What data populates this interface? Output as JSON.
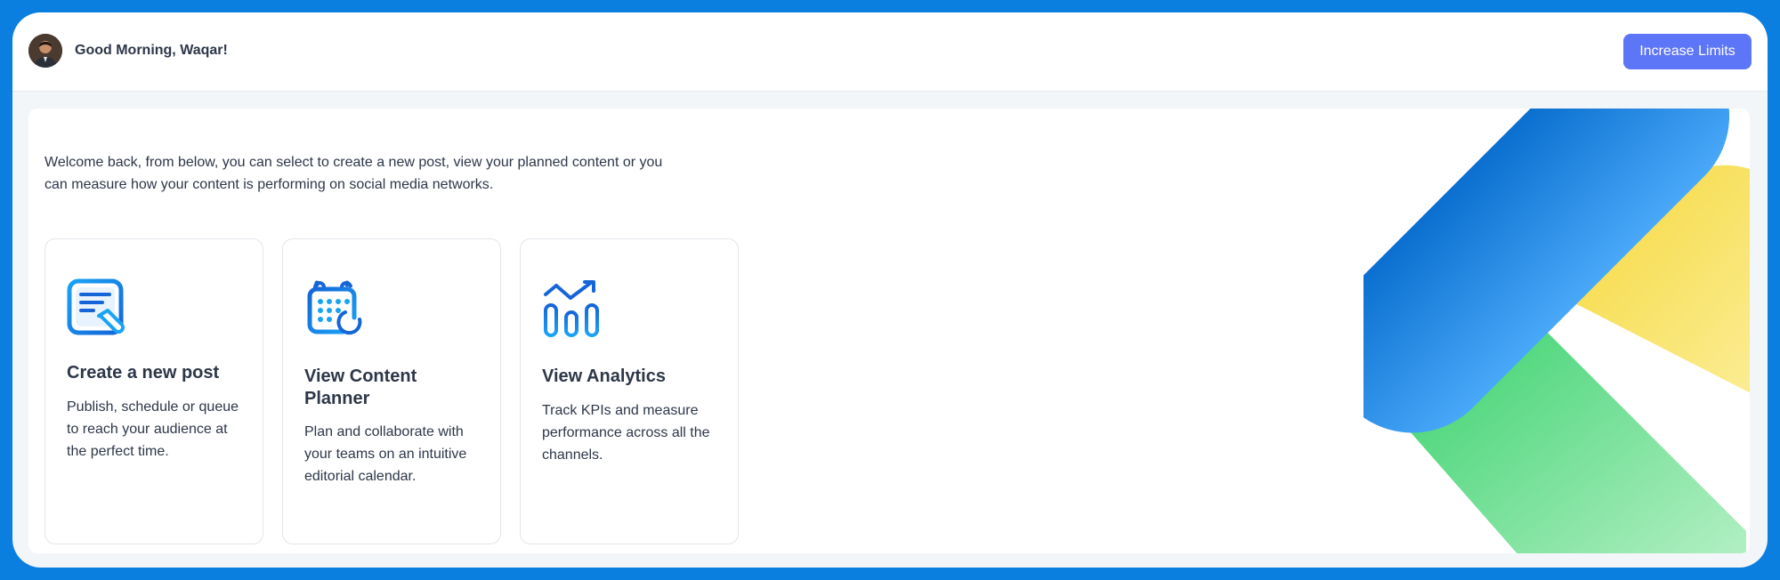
{
  "header": {
    "greeting": "Good Morning, Waqar!",
    "cta_label": "Increase Limits"
  },
  "main": {
    "welcome_text": "Welcome back, from below, you can select to create a new post, view your planned content or you can measure how your content is performing on social media networks.",
    "cards": [
      {
        "icon": "edit-post-icon",
        "title": "Create a new post",
        "description": "Publish, schedule or queue to reach your audience at the perfect time."
      },
      {
        "icon": "calendar-icon",
        "title": "View Content Planner",
        "description": "Plan and collaborate with your teams on an intuitive editorial calendar."
      },
      {
        "icon": "analytics-icon",
        "title": "View Analytics",
        "description": "Track KPIs and measure performance across all the channels."
      }
    ]
  },
  "colors": {
    "frame": "#0b7fe0",
    "accent_button": "#5d75f7",
    "icon_blue": "#1565d8",
    "icon_light": "#1aa3f5",
    "deco_blue": "#1e7ee4",
    "deco_green": "#3ed474",
    "deco_yellow": "#f7df4a"
  }
}
